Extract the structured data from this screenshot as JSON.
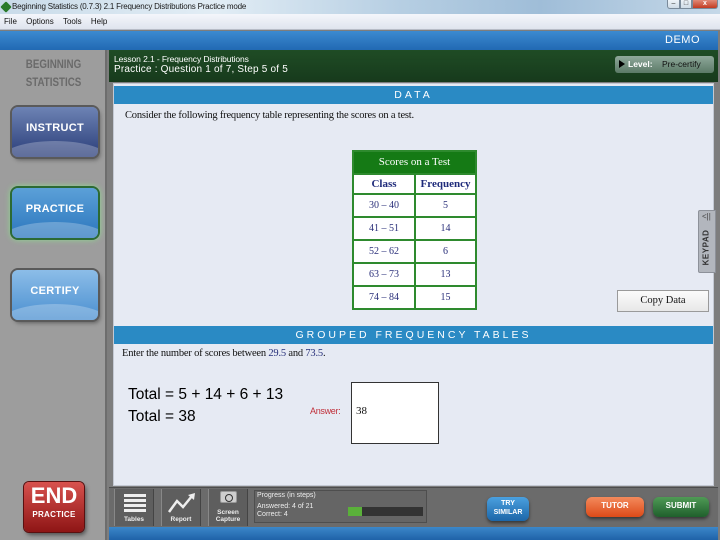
{
  "window": {
    "title": "Beginning Statistics (0.7.3)   2.1 Frequency Distributions    Practice mode",
    "controls": {
      "minimize": "–",
      "maximize": "□",
      "close": "x"
    }
  },
  "menu": [
    "File",
    "Options",
    "Tools",
    "Help"
  ],
  "header": {
    "badge": "DEMO"
  },
  "sidebar": {
    "logo_line1": "BEGINNING",
    "logo_line2": "STATISTICS",
    "nav": [
      {
        "label": "INSTRUCT",
        "active": false
      },
      {
        "label": "PRACTICE",
        "active": true
      },
      {
        "label": "CERTIFY",
        "active": false
      }
    ],
    "end_button": {
      "big": "END",
      "small": "PRACTICE"
    }
  },
  "lesson": {
    "title": "Lesson 2.1 - Frequency Distributions",
    "subtitle": "Practice : Question 1 of 7, Step 5 of 5",
    "level_label": "Level:",
    "level_value": "Pre-certify"
  },
  "data_section": {
    "heading": "DATA",
    "prompt": "Consider the following frequency table representing the scores on a test.",
    "table": {
      "caption": "Scores on a Test",
      "headers": [
        "Class",
        "Frequency"
      ],
      "rows": [
        [
          "30 – 40",
          "5"
        ],
        [
          "41 – 51",
          "14"
        ],
        [
          "52 – 62",
          "6"
        ],
        [
          "63 – 73",
          "13"
        ],
        [
          "74 – 84",
          "15"
        ]
      ]
    },
    "copy_button": "Copy Data"
  },
  "keypad": {
    "chevron": "<||",
    "label": "KEYPAD"
  },
  "grouped_section": {
    "heading": "GROUPED FREQUENCY TABLES",
    "prompt_before": "Enter the number of scores between ",
    "lower": "29.5",
    "prompt_mid": " and ",
    "upper": "73.5",
    "prompt_end": ".",
    "work_line1": "Total = 5 + 14 + 6 + 13",
    "work_line2": "Total = 38",
    "answer_label": "Answer:",
    "answer_value": "38"
  },
  "toolbar": {
    "tables": "Tables",
    "report": "Report",
    "capture_line1": "Screen",
    "capture_line2": "Capture",
    "progress": {
      "title": "Progress (in steps)",
      "answered": "Answered:  4 of 21",
      "correct": "Correct:     4",
      "answered_count": 4,
      "total": 21
    },
    "try_line1": "TRY",
    "try_line2": "SIMILAR",
    "tutor": "TUTOR",
    "submit": "SUBMIT"
  }
}
